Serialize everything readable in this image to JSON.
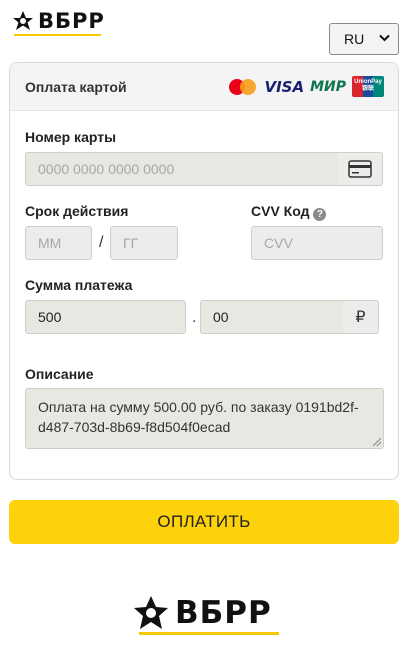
{
  "brand": {
    "name": "ВБРР",
    "accent": "#f5c800"
  },
  "language": {
    "selected": "RU"
  },
  "form": {
    "title": "Оплата картой",
    "payment_systems": {
      "mastercard": "mastercard-logo",
      "visa": "VISA",
      "mir": "МИР",
      "unionpay": "UnionPay 银联"
    },
    "card_number": {
      "label": "Номер карты",
      "placeholder": "0000 0000 0000 0000"
    },
    "expiry": {
      "label": "Срок действия",
      "month_placeholder": "ММ",
      "separator": "/",
      "year_placeholder": "ГГ"
    },
    "cvv": {
      "label": "CVV Код",
      "placeholder": "CVV",
      "help": "?"
    },
    "amount": {
      "label": "Сумма платежа",
      "rubles": "500",
      "separator": ".",
      "kopecks": "00",
      "currency": "₽"
    },
    "description": {
      "label": "Описание",
      "value": "Оплата на сумму 500.00 руб. по заказу 0191bd2f-d487-703d-8b69-f8d504f0ecad"
    }
  },
  "pay_button": {
    "label": "ОПЛАТИТЬ",
    "color": "#fdd20b"
  }
}
